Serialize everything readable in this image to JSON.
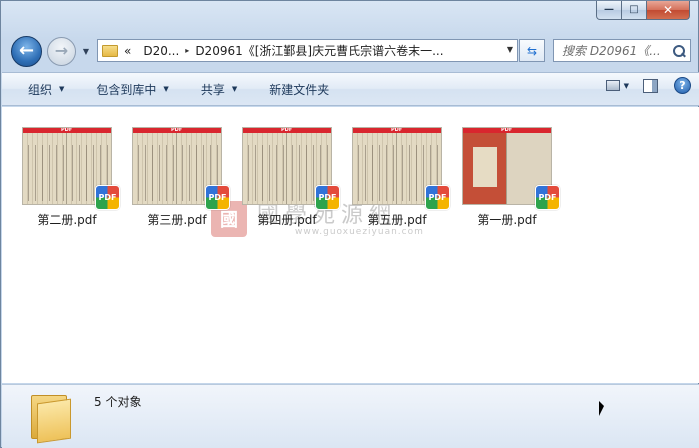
{
  "window": {
    "caption": {
      "minimize_glyph": "—",
      "maximize_glyph": "□",
      "close_glyph": "✕"
    }
  },
  "nav": {
    "back_icon": "arrow-left-icon",
    "forward_icon": "arrow-right-icon"
  },
  "address": {
    "overflow": "«",
    "crumbs": [
      "D20...",
      "D20961《[浙江鄞县]庆元曹氏宗谱六卷末一..."
    ],
    "separator": "▸"
  },
  "search": {
    "placeholder": "搜索 D20961《..."
  },
  "toolbar": {
    "organize": "组织",
    "include_in_library": "包含到库中",
    "share": "共享",
    "new_folder": "新建文件夹"
  },
  "files": [
    {
      "name": "第二册.pdf",
      "thumb_style": "book"
    },
    {
      "name": "第三册.pdf",
      "thumb_style": "book"
    },
    {
      "name": "第四册.pdf",
      "thumb_style": "book"
    },
    {
      "name": "第五册.pdf",
      "thumb_style": "book"
    },
    {
      "name": "第一册.pdf",
      "thumb_style": "cover-red"
    }
  ],
  "thumb_badge": "PDF",
  "watermark": {
    "logo": "國",
    "text": "國學苑源網",
    "url": "www.guoxueziyuan.com"
  },
  "status": {
    "count_text": "5 个对象"
  },
  "colors": {
    "accent": "#1e395b",
    "pdf_red": "#d9262e"
  }
}
